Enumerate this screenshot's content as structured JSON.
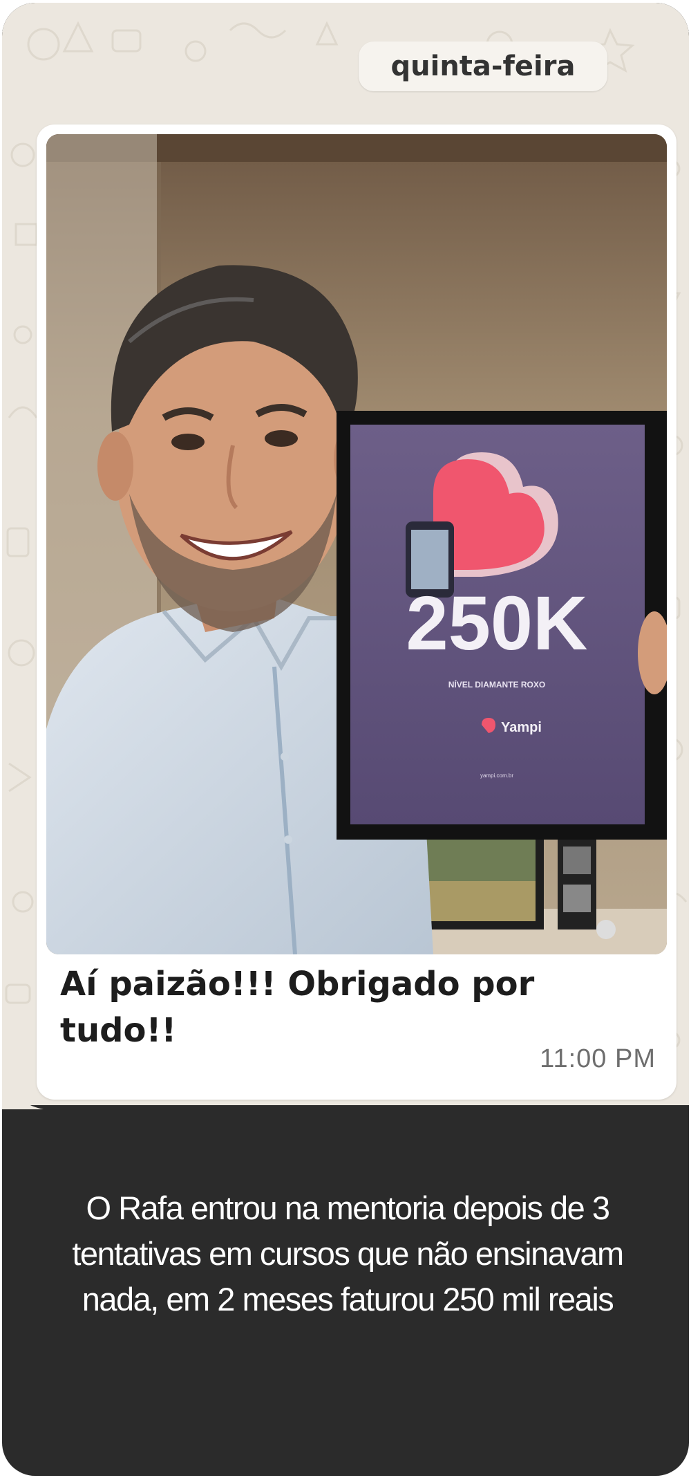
{
  "chat": {
    "day_label": "quinta-feira",
    "message": {
      "caption": "Aí paizão!!! Obrigado por tudo!!",
      "time": "11:00 PM"
    },
    "photo": {
      "plaque_value": "250K",
      "plaque_level": "NÍVEL DIAMANTE ROXO",
      "plaque_brand": "Yampi",
      "plaque_url": "yampi.com.br"
    }
  },
  "testimonial": {
    "text": "O Rafa entrou na mentoria depois de 3 tentativas em cursos que não ensinavam nada, em 2 meses faturou 250 mil reais"
  },
  "colors": {
    "chat_background": "#ece7df",
    "bubble": "#ffffff",
    "panel": "#2b2b2b",
    "brand_pink": "#f0566e"
  }
}
